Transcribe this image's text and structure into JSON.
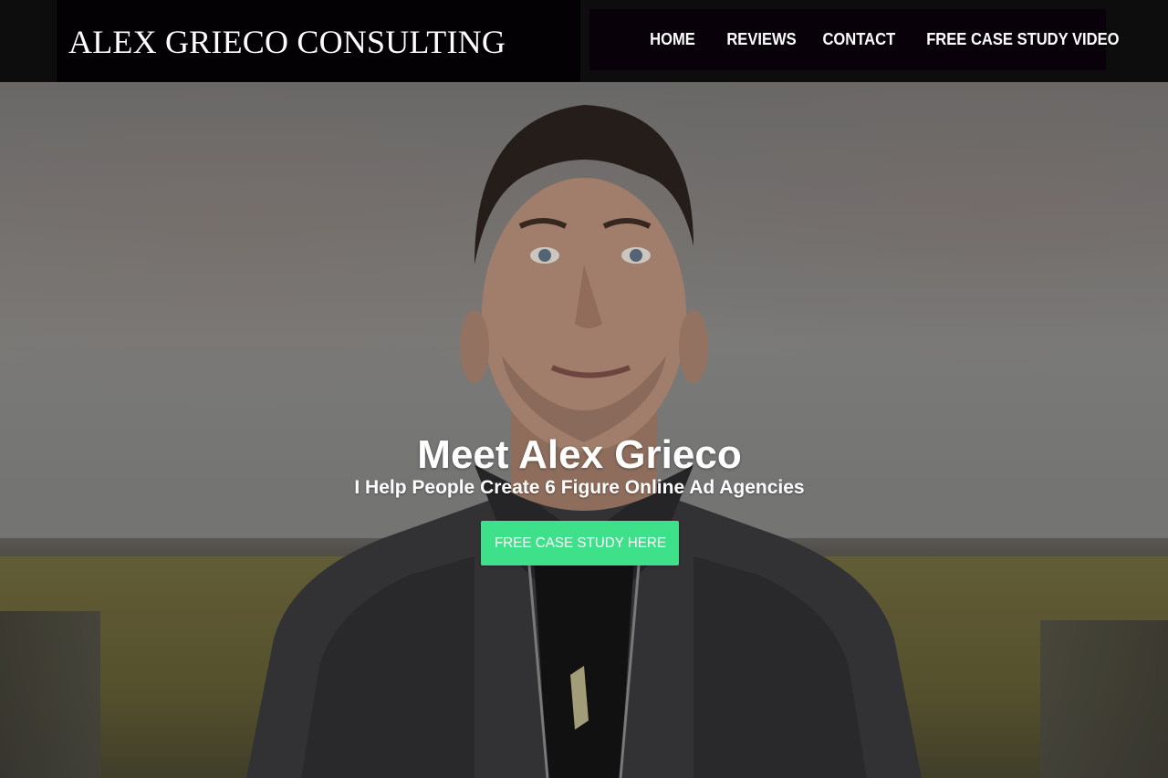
{
  "header": {
    "brand": "ALEX GRIECO CONSULTING",
    "nav": [
      {
        "label": "HOME"
      },
      {
        "label": "REVIEWS"
      },
      {
        "label": "CONTACT"
      },
      {
        "label": "FREE CASE STUDY VIDEO"
      }
    ]
  },
  "hero": {
    "title": "Meet Alex Grieco",
    "subtitle": "I Help People Create 6 Figure Online Ad Agencies",
    "cta_label": "FREE CASE STUDY HERE",
    "image": "portrait-photo"
  },
  "colors": {
    "header_bg": "#0d0d0d",
    "nav_bg": "#08010a",
    "cta_bg": "#3fe08a",
    "text": "#ffffff"
  }
}
